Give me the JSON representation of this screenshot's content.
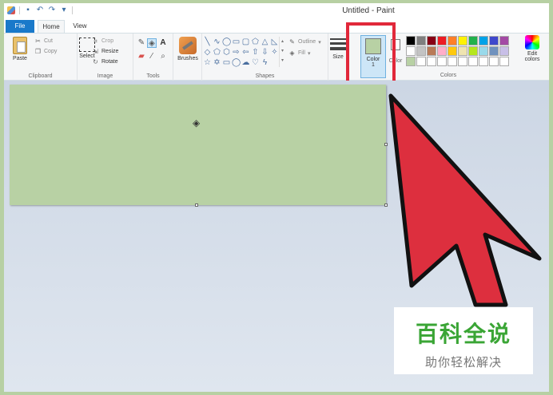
{
  "window": {
    "title": "Untitled - Paint"
  },
  "quick_access": {
    "icons": [
      "paint-app-icon",
      "save-icon",
      "undo-icon",
      "redo-icon",
      "customize-icon"
    ]
  },
  "tabs": [
    {
      "label": "File"
    },
    {
      "label": "Home"
    },
    {
      "label": "View"
    }
  ],
  "clipboard": {
    "paste": "Paste",
    "cut": "Cut",
    "copy": "Copy",
    "label": "Clipboard"
  },
  "image": {
    "select": "Select",
    "crop": "Crop",
    "resize": "Resize",
    "rotate": "Rotate",
    "label": "Image"
  },
  "tools": {
    "label": "Tools"
  },
  "brushes": {
    "label": "Brushes"
  },
  "shapes": {
    "outline": "Outline",
    "fill": "Fill",
    "label": "Shapes"
  },
  "size": {
    "label": "Size"
  },
  "colors": {
    "color1_label": "Color",
    "color1_num": "1",
    "color2_label": "Color",
    "edit_label": "Edit",
    "edit_label2": "colors",
    "label": "Colors",
    "color1_value": "#b8d1a4",
    "palette": [
      "#000000",
      "#7f7f7f",
      "#880015",
      "#ed1c24",
      "#ff7f27",
      "#fff200",
      "#22b14c",
      "#00a2e8",
      "#3f48cc",
      "#a349a4",
      "#ffffff",
      "#c3c3c3",
      "#b97a57",
      "#ffaec9",
      "#ffc90e",
      "#efe4b0",
      "#b5e61d",
      "#99d9ea",
      "#7092be",
      "#c8bfe7",
      "#b8d1a4",
      "#ffffff",
      "#ffffff",
      "#ffffff",
      "#ffffff",
      "#ffffff",
      "#ffffff",
      "#ffffff",
      "#ffffff",
      "#ffffff"
    ]
  },
  "canvas": {
    "fill_color": "#b8d1a4"
  },
  "highlight_color": "#e1283a",
  "watermark": {
    "line1": "百科全说",
    "line2": "助你轻松解决"
  }
}
